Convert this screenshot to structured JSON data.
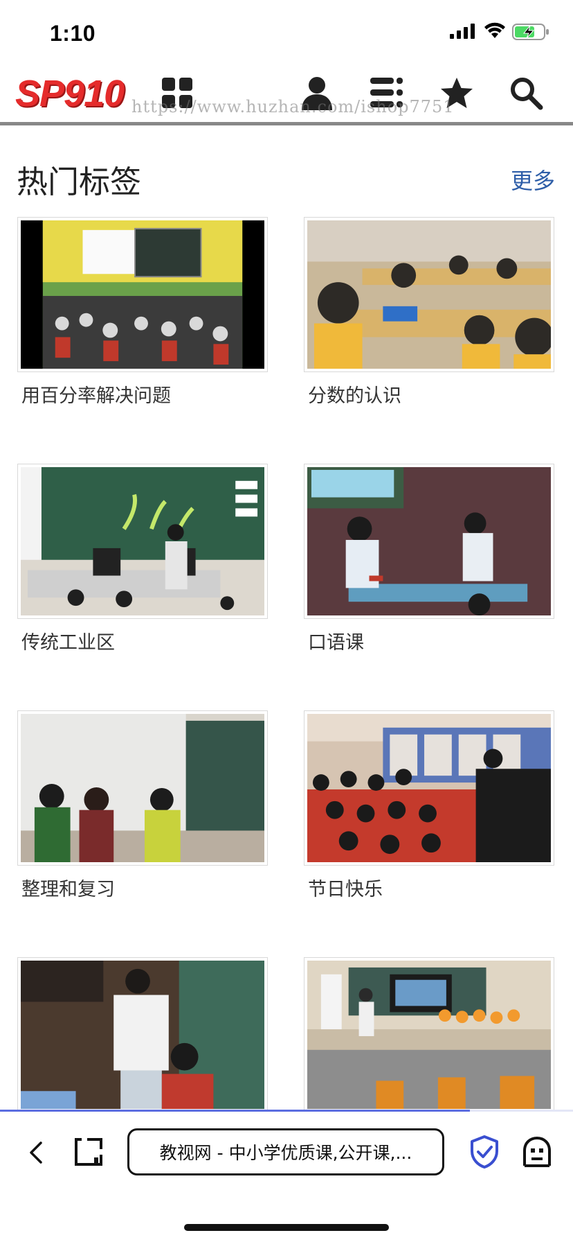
{
  "status_bar": {
    "time": "1:10"
  },
  "header": {
    "logo": "SP910",
    "watermark": "https://www.huzhan.com/ishop7751",
    "icons": [
      "grid-icon",
      "user-icon",
      "list-icon",
      "star-icon",
      "search-icon"
    ]
  },
  "section": {
    "title": "热门标签",
    "more": "更多"
  },
  "tags": [
    {
      "label": "用百分率解决问题",
      "thumb": "classroom-green-wall"
    },
    {
      "label": "分数的认识",
      "thumb": "students-yellow-vests"
    },
    {
      "label": "传统工业区",
      "thumb": "teacher-at-chalkboard"
    },
    {
      "label": "口语课",
      "thumb": "two-boys-phone-roleplay"
    },
    {
      "label": "整理和复习",
      "thumb": "students-at-whiteboard"
    },
    {
      "label": "节日快乐",
      "thumb": "children-red-uniforms"
    },
    {
      "label": "",
      "thumb": "teacher-with-microphone"
    },
    {
      "label": "",
      "thumb": "classroom-with-screen"
    }
  ],
  "page_load_progress": 0.82,
  "toolbar": {
    "url_title": "教视网 - 中小学优质课,公开课,...",
    "icons": [
      "back-icon",
      "tabs-icon",
      "shield-check-icon",
      "ghost-icon"
    ]
  },
  "colors": {
    "logo": "#e52b2b",
    "link": "#2e5ea8",
    "shield": "#3a4fd0",
    "progress": "#5b6de0"
  }
}
